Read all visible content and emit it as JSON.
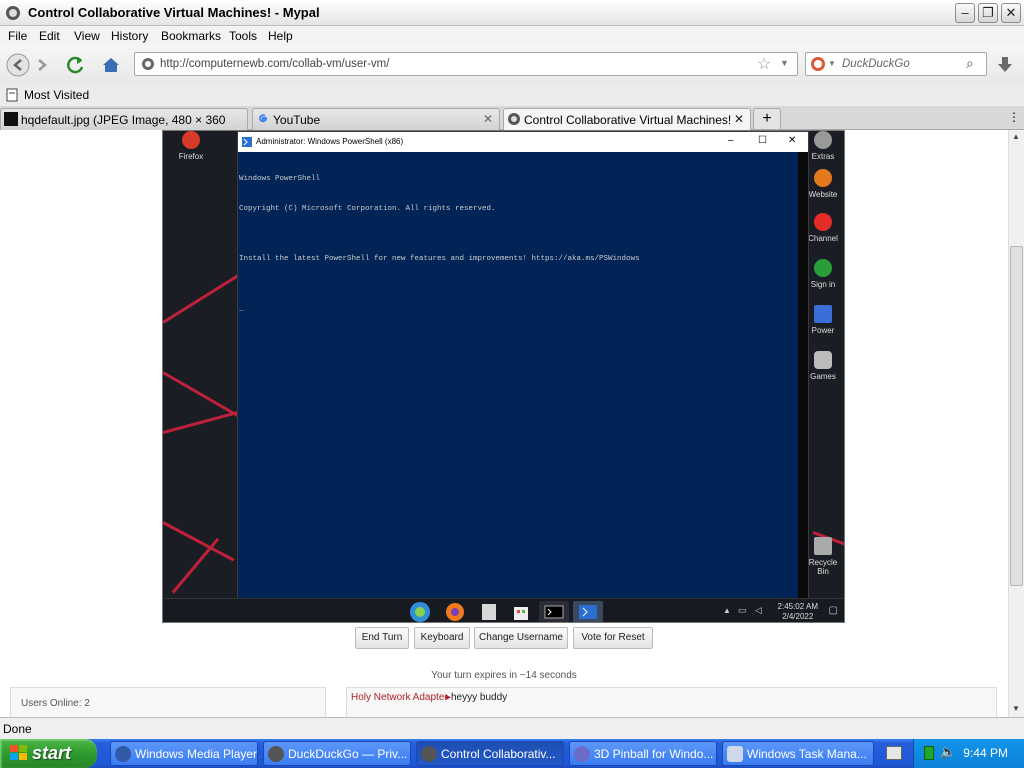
{
  "window": {
    "title": "Control Collaborative Virtual Machines! - Mypal"
  },
  "menu": [
    "File",
    "Edit",
    "View",
    "History",
    "Bookmarks",
    "Tools",
    "Help"
  ],
  "nav": {
    "url": "http://computernewb.com/collab-vm/user-vm/",
    "search_placeholder": "DuckDuckGo"
  },
  "bookmarks": {
    "most_visited": "Most Visited"
  },
  "tabs": [
    {
      "label": "hqdefault.jpg (JPEG Image, 480 × 360 pi...",
      "active": false
    },
    {
      "label": "YouTube",
      "active": false
    },
    {
      "label": "Control Collaborative Virtual Machines!",
      "active": true
    }
  ],
  "vm": {
    "desktop_icons": [
      "Firefox",
      "Extras",
      "Website",
      "Channel",
      "Sign in",
      "Power",
      "Games",
      "Recycle Bin"
    ],
    "powershell": {
      "title": "Administrator: Windows PowerShell (x86)",
      "lines": [
        "Windows PowerShell",
        "Copyright (C) Microsoft Corporation. All rights reserved.",
        "",
        "Install the latest PowerShell for new features and improvements! https://aka.ms/PSWindows",
        "",
        "_"
      ]
    },
    "clock": {
      "time": "2:45:02 AM",
      "date": "2/4/2022"
    }
  },
  "controls": {
    "end_turn": "End Turn",
    "keyboard": "Keyboard",
    "change_username": "Change Username",
    "vote_reset": "Vote for Reset",
    "turn_expires": "Your turn expires in ~14 seconds"
  },
  "users": {
    "online": "Users Online: 2"
  },
  "chat": {
    "user": "Holy Network Adapter",
    "message": "heyyy buddy"
  },
  "status": {
    "text": "Done"
  },
  "taskbar": {
    "start": "start",
    "tasks": [
      {
        "label": "Windows Media Player",
        "active": false
      },
      {
        "label": "DuckDuckGo — Priv...",
        "active": false
      },
      {
        "label": "Control Collaborativ...",
        "active": true
      },
      {
        "label": "3D Pinball for Windo...",
        "active": false
      },
      {
        "label": "Windows Task Mana...",
        "active": false
      }
    ],
    "clock": "9:44 PM"
  }
}
